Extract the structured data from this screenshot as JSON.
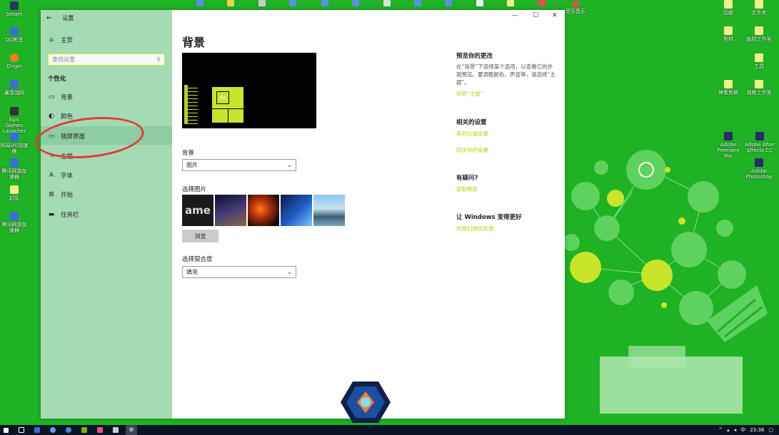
{
  "desktop": {
    "left_icons": [
      {
        "label": "Steam"
      },
      {
        "label": "QQ影音"
      },
      {
        "label": "Origin"
      },
      {
        "label": "暴雪战网"
      },
      {
        "label": "Epic Games Launcher"
      },
      {
        "label": "网易UU加速器"
      },
      {
        "label": "腾讯网游加速器"
      },
      {
        "label": "赶乱"
      },
      {
        "label": "腾讯网游加速器"
      }
    ],
    "top_right_icon": "音乐音乐",
    "right_icons": [
      {
        "label": "回收"
      },
      {
        "label": "文件夹"
      },
      {
        "label": "型材"
      },
      {
        "label": "临时工作室"
      },
      {
        "label": "工具"
      },
      {
        "label": "神策剪辑"
      },
      {
        "label": "视频工作室"
      },
      {
        "label": "Adobe Premiere Pro"
      },
      {
        "label": "Adobe After Effects CC"
      },
      {
        "label": "Adobe Photoshop"
      }
    ]
  },
  "window": {
    "app_title": "设置",
    "controls": {
      "minimize": "—",
      "maximize": "☐",
      "close": "✕"
    },
    "sidebar": {
      "home": "主页",
      "search_placeholder": "查找设置",
      "section": "个性化",
      "items": [
        {
          "label": "背景",
          "icon": "picture-icon"
        },
        {
          "label": "颜色",
          "icon": "palette-icon"
        },
        {
          "label": "锁屏界面",
          "icon": "monitor-icon"
        },
        {
          "label": "主题",
          "icon": "brush-icon"
        },
        {
          "label": "字体",
          "icon": "font-icon"
        },
        {
          "label": "开始",
          "icon": "start-icon"
        },
        {
          "label": "任务栏",
          "icon": "taskbar-icon"
        }
      ]
    },
    "main": {
      "title": "背景",
      "preview_tile_text": "Aa",
      "background_label": "背景",
      "background_value": "图片",
      "choose_picture_label": "选择图片",
      "thumb_text": "ame",
      "browse_label": "浏览",
      "fit_label": "选择契合度",
      "fit_value": "填充"
    },
    "right": {
      "preview_head": "预览你的更改",
      "preview_text": "在“背景”下选择某个选项，以查看它的外观预览。要调整颜色、声音等，请选择“主题”。",
      "preview_link": "转到“主题”",
      "related_head": "相关的设置",
      "related_link1": "高对比度设置",
      "related_link2": "同步你的设置",
      "question_head": "有疑问?",
      "question_link": "获取帮助",
      "improve_head": "让 Windows 变得更好",
      "improve_link": "向我们提供反馈"
    }
  },
  "taskbar": {
    "tray_lang": "中",
    "time": "23:38"
  },
  "colors": {
    "desktop": "#1fb224",
    "sidebar": "#a4dab4",
    "accent": "#c8e52a",
    "highlight_circle": "#e53a3a"
  }
}
